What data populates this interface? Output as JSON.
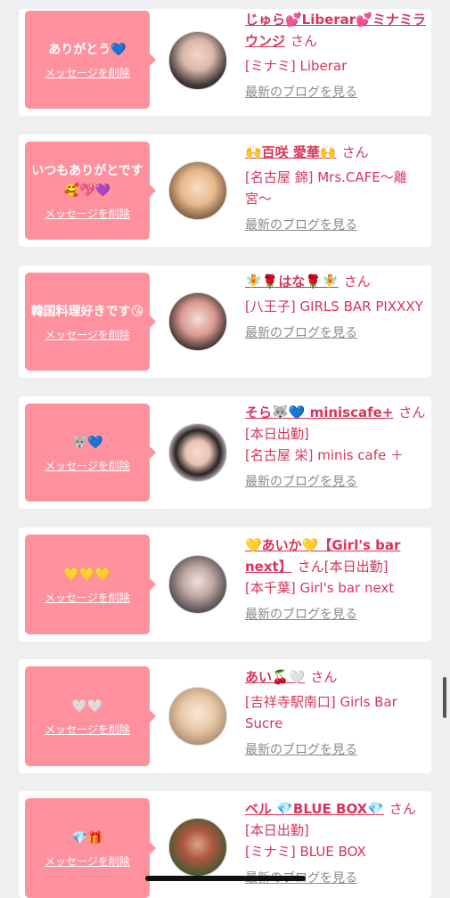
{
  "items": [
    {
      "message": "ありがとう💙",
      "delete_label": "メッセージを削除",
      "name": "じゅら💕Liberar💕ミナミラウンジ",
      "san": "さん",
      "status": "",
      "shop": "[ミナミ] Liberar",
      "blog_label": "最新のブログを見る",
      "bubble_color": "#ff919f"
    },
    {
      "message": "いつもありがとです🥰💖💜",
      "delete_label": "メッセージを削除",
      "name": "🙌百咲 愛華🙌",
      "san": "さん",
      "status": "",
      "shop": "[名古屋 錦] Mrs.CAFE〜離宮〜",
      "blog_label": "最新のブログを見る",
      "bubble_color": "#ff919f"
    },
    {
      "message": "韓国料理好きです😘",
      "delete_label": "メッセージを削除",
      "name": "🧚🌹はな🌹🧚",
      "san": "さん",
      "status": "",
      "shop": "[八王子] GIRLS BAR PIXXXY",
      "blog_label": "最新のブログを見る",
      "bubble_color": "#ff919f"
    },
    {
      "message": "🐺💙",
      "delete_label": "メッセージを削除",
      "name": "そら🐺💙 miniscafe+",
      "san": "さん",
      "status": "[本日出勤]",
      "shop": "[名古屋 栄] minis cafe ＋",
      "blog_label": "最新のブログを見る",
      "bubble_color": "#ff919f"
    },
    {
      "message": "💛💛💛",
      "delete_label": "メッセージを削除",
      "name": "💛あいか💛【Girl's bar next】",
      "san": "さん",
      "status": "[本日出勤]",
      "shop": "[本千葉] Girl's bar next",
      "blog_label": "最新のブログを見る",
      "bubble_color": "#ff919f"
    },
    {
      "message": "🤍🤍",
      "delete_label": "メッセージを削除",
      "name": "あい🍒🤍",
      "san": "さん",
      "status": "",
      "shop": "[吉祥寺駅南口] Girls Bar Sucre",
      "blog_label": "最新のブログを見る",
      "bubble_color": "#ff919f"
    },
    {
      "message": "💎🎁",
      "delete_label": "メッセージを削除",
      "name": "ベル 💎BLUE BOX💎",
      "san": "さん",
      "status": "[本日出勤]",
      "shop": "[ミナミ] BLUE BOX",
      "blog_label": "最新のブログを見る",
      "bubble_color": "#ff919f"
    }
  ],
  "colors": {
    "accent": "#d9345a",
    "bubble": "#ff919f",
    "link_gray": "#8a8a8a",
    "background": "#efefef"
  }
}
